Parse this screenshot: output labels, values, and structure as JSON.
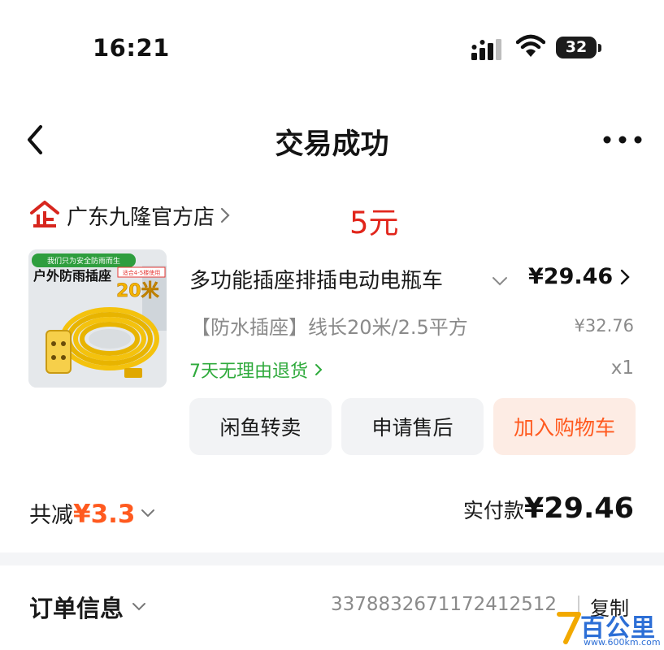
{
  "status_bar": {
    "time": "16:21",
    "battery": "32"
  },
  "nav": {
    "title": "交易成功"
  },
  "store": {
    "name": "广东九隆官方店",
    "note_price": "5元"
  },
  "product": {
    "image_badge_top": "我们只为安全防雨而生",
    "image_title": "户外防雨插座",
    "image_tag": "适合4-5楼使用",
    "image_length": "20米",
    "title": "多功能插座排插电动电瓶车",
    "price": "¥29.46",
    "sku": "【防水插座】线长20米/2.5平方",
    "original_price": "¥32.76",
    "return_policy": "7天无理由退货",
    "quantity": "x1"
  },
  "actions": {
    "resell": "闲鱼转卖",
    "after_sale": "申请售后",
    "add_to_cart": "加入购物车"
  },
  "summary": {
    "discount_label": "共减",
    "discount_currency": "¥",
    "discount_amount": "3.3",
    "paid_label": "实付款",
    "paid_currency": "¥",
    "paid_amount": "29.46"
  },
  "order_info": {
    "label": "订单信息",
    "number": "3378832671172412512",
    "copy_label": "复制"
  },
  "watermark": {
    "text": "百公里",
    "url": "www.600km.com"
  },
  "colors": {
    "accent_orange": "#ff5a1f",
    "note_red": "#e1251b",
    "green": "#2faa3c",
    "muted_gray": "#8a8a8a"
  }
}
